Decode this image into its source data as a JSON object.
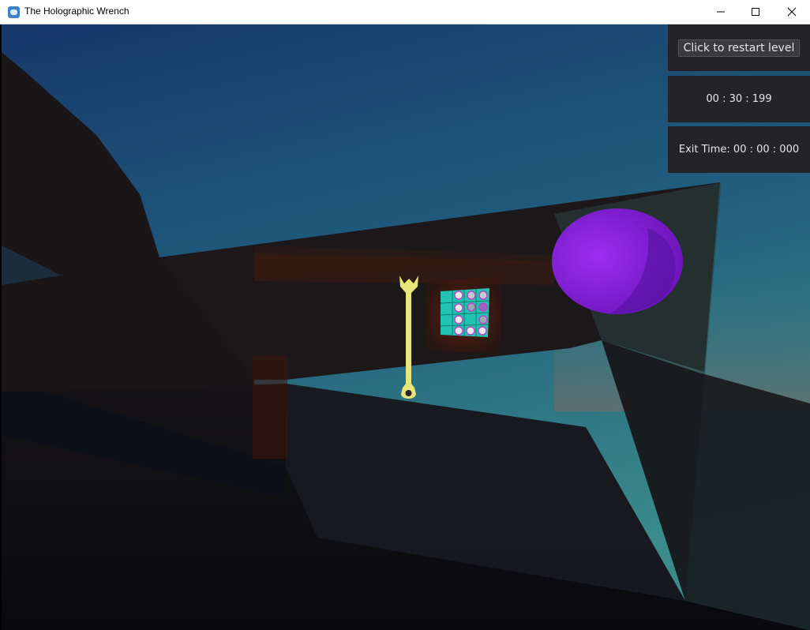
{
  "window": {
    "title": "The Holographic Wrench",
    "icon": "godot-icon",
    "controls": [
      "minimize-icon",
      "maximize-icon",
      "close-icon"
    ]
  },
  "hud": {
    "restart_label": "Click to restart level",
    "timer": "00 : 30 : 199",
    "exit_time": "Exit Time: 00 : 00 : 000"
  },
  "scene": {
    "objects": [
      "yellow-wrench",
      "puzzle-grid-panel",
      "purple-sphere",
      "dark-room-walls",
      "sky"
    ],
    "colors": {
      "sky_top": "#1d4a7a",
      "sky_horizon": "#3b8a8c",
      "wrench": "#e6e67a",
      "sphere": "#8a22d6",
      "panel_frame": "#7a1c0a",
      "grid_tile": "#22c4b4"
    }
  }
}
